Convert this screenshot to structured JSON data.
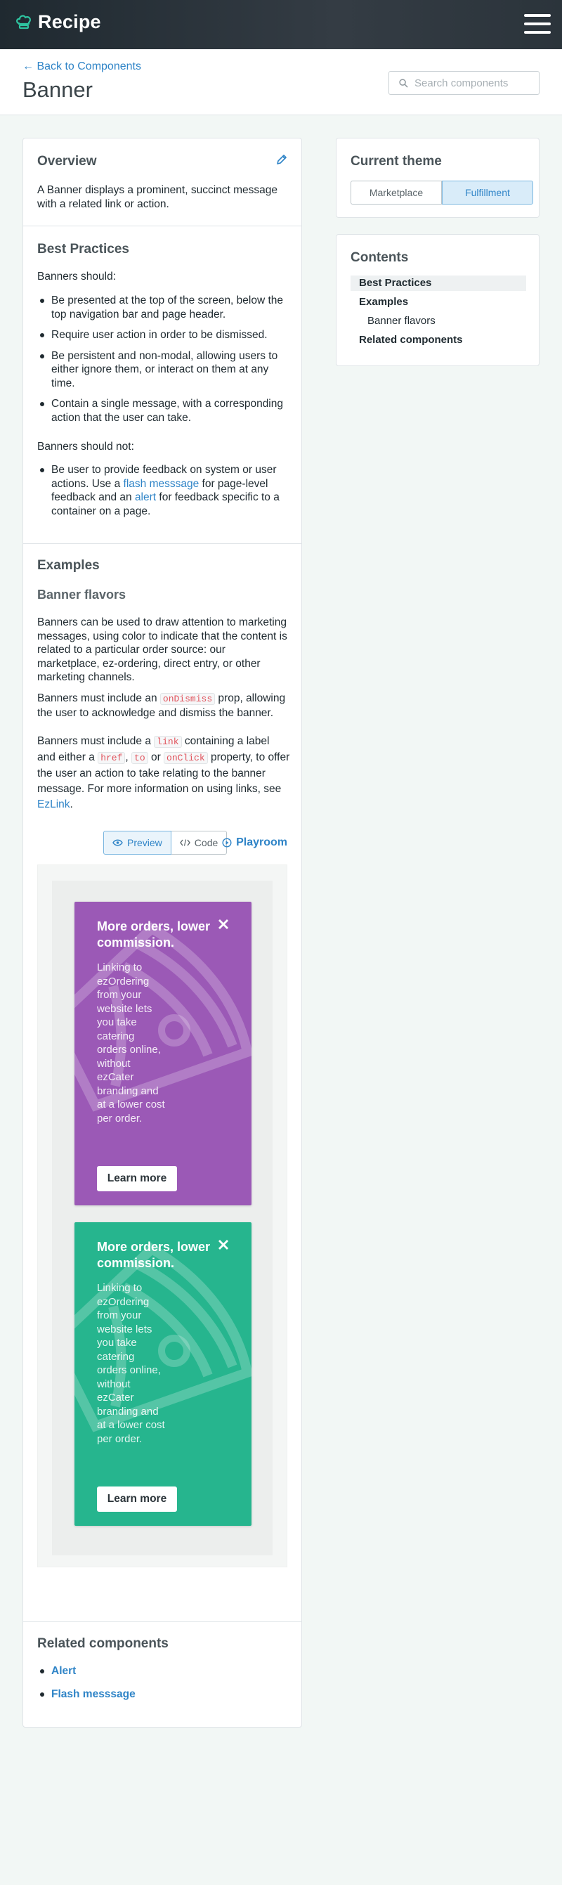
{
  "topbar": {
    "logo_text": "Recipe"
  },
  "header": {
    "back_link": "← Back to Components",
    "title": "Banner",
    "search_placeholder": "Search components"
  },
  "overview": {
    "title": "Overview",
    "text": "A Banner displays a prominent, succinct message with a related link or action."
  },
  "best_practices": {
    "title": "Best Practices",
    "should_label": "Banners should:",
    "should_items": [
      "Be presented at the top of the screen, below the top navigation bar and page header.",
      "Require user action in order to be dismissed.",
      "Be persistent and non-modal, allowing users to either ignore them, or interact on them at any time.",
      "Contain a single message, with a corresponding action that the user can take."
    ],
    "should_not_label": "Banners should not:",
    "should_not_item": {
      "before": "Be user to provide feedback on system or user actions. Use a ",
      "link1": "flash messsage",
      "middle": " for page-level feedback and an ",
      "link2": "alert",
      "after": " for feedback specific to a container on a page."
    }
  },
  "examples": {
    "title": "Examples",
    "subtitle": "Banner flavors",
    "p1": "Banners can be used to draw attention to marketing messages, using color to indicate that the content is related to a particular order source: our marketplace, ez-ordering, direct entry, or other marketing channels.",
    "p2": {
      "before": "Banners must include an ",
      "code": "onDismiss",
      "after": " prop, allowing the user to acknowledge and dismiss the banner."
    },
    "p3": {
      "a": "Banners must include a ",
      "code1": "link",
      "b": " containing a label and either a ",
      "code2": "href",
      "c": ", ",
      "code3": "to",
      "d": " or ",
      "code4": "onClick",
      "e": " property, to offer the user an action to take relating to the banner message. For more information on using links, see ",
      "link": "EzLink",
      "f": "."
    },
    "toggle": {
      "preview": "Preview",
      "code": "Code",
      "playroom": "Playroom"
    },
    "banners": [
      {
        "color": "#9b59b6",
        "title": "More orders, lower commission.",
        "body": "Linking to ezOrdering from your website lets you take catering orders online, without ezCater branding and at a lower cost per order.",
        "button": "Learn more"
      },
      {
        "color": "#26b58e",
        "title": "More orders, lower commission.",
        "body": "Linking to ezOrdering from your website lets you take catering orders online, without ezCater branding and at a lower cost per order.",
        "button": "Learn more"
      }
    ]
  },
  "related": {
    "title": "Related components",
    "items": [
      "Alert",
      "Flash messsage"
    ]
  },
  "theme": {
    "title": "Current theme",
    "options": [
      "Marketplace",
      "Fulfillment"
    ],
    "selected": "Fulfillment"
  },
  "contents": {
    "title": "Contents",
    "items": [
      "Best Practices",
      "Examples",
      "Banner flavors",
      "Related components"
    ]
  }
}
